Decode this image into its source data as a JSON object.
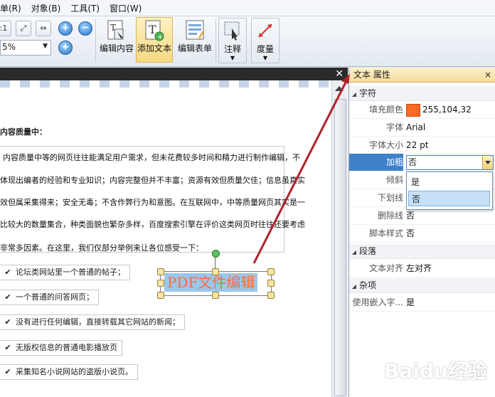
{
  "menu": [
    "单(R)",
    "对象(B)",
    "工具(T)",
    "窗口(W)"
  ],
  "ribbon": {
    "zoom_value": "5%",
    "buttons": [
      "编辑内容",
      "添加文本",
      "编辑表单",
      "注释",
      "度量"
    ]
  },
  "document": {
    "heading": "内容质量中：",
    "paragraph_lines": [
      "内容质量中等的网页往往能满足用户需求，但未花费较多时间和精力进行制作编辑，不",
      "体现出编者的经验和专业知识；内容完整但并不丰富；资源有效但质量欠佳；信息虽真实",
      "效但属采集得来；安全无毒；不含作弊行为和意图。在互联网中，中等质量网页其实是一",
      "比较大的数量集合，种类面貌也繁杂多样，百度搜索引擎在评价这类网页时往往还要考虑",
      "非常多因素。在这里，我们仅部分举例来让各位感受一下："
    ],
    "check_items": [
      "论坛类网站里一个普通的帖子；",
      "一个普通的问答网页；",
      "没有进行任何编辑，直接转载其它网站的新闻；",
      "无版权信息的普通电影播放页",
      "采集知名小说网站的盗版小说页。"
    ],
    "selected_text": "PDF文件编辑"
  },
  "properties": {
    "title": "文本 属性",
    "sections": {
      "char": "字符",
      "para": "段落",
      "misc": "杂项"
    },
    "rows": {
      "fill_color_label": "填充颜色",
      "fill_color_value": "255,104,32",
      "font_label": "字体",
      "font_value": "Arial",
      "size_label": "字体大小",
      "size_value": "22 pt",
      "bold_label": "加粗",
      "bold_value": "否",
      "italic_label": "倾斜",
      "underline_label": "下划线",
      "strike_label": "删除线",
      "strike_value": "否",
      "script_label": "脚本样式",
      "script_value": "否",
      "align_label": "文本对齐",
      "align_value": "左对齐",
      "embed_label": "使用嵌入字...",
      "embed_value": "是"
    },
    "dropdown_options": [
      "是",
      "否"
    ],
    "fill_color_hex": "#ff6820"
  },
  "watermark": "Baidu经验"
}
